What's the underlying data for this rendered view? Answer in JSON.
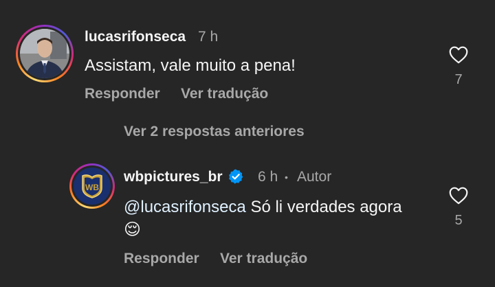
{
  "comments": [
    {
      "username": "lucasrifonseca",
      "time": "7 h",
      "text": "Assistam, vale muito a pena!",
      "reply_label": "Responder",
      "translate_label": "Ver tradução",
      "likes": "7"
    },
    {
      "username": "wbpictures_br",
      "time": "6 h",
      "separator": "•",
      "author_badge": "Autor",
      "mention": "@lucasrifonseca",
      "text": " Só li verdades agora",
      "emoji": "😌",
      "reply_label": "Responder",
      "translate_label": "Ver tradução",
      "likes": "5",
      "avatar_logo_text": "WB"
    }
  ],
  "view_previous_replies": "Ver 2 respostas anteriores",
  "colors": {
    "background": "#262626",
    "text_primary": "#f5f5f5",
    "text_secondary": "#a8a8a8",
    "verified_blue": "#0095f6",
    "wb_blue": "#1a2f6e",
    "wb_gold": "#c9a33c"
  },
  "icons": {
    "like": "heart-outline-icon",
    "verified": "verified-badge-icon"
  }
}
